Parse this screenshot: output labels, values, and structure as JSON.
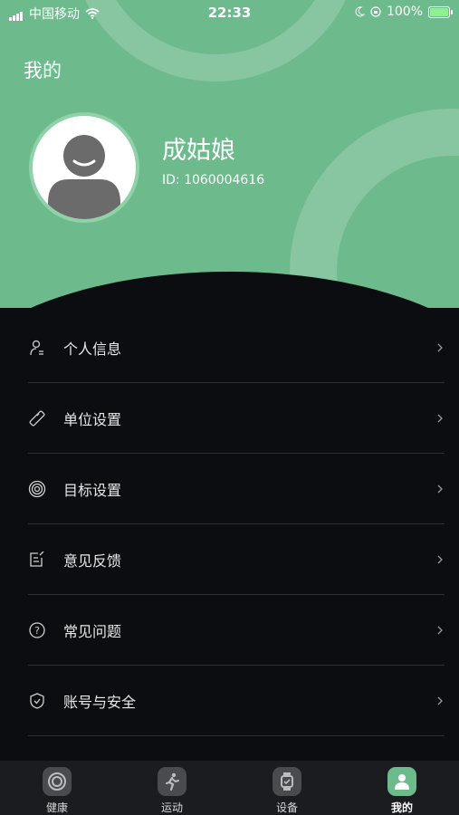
{
  "status_bar": {
    "carrier": "中国移动",
    "time": "22:33",
    "battery": "100%"
  },
  "header": {
    "title": "我的",
    "username": "成姑娘",
    "user_id": "ID: 1060004616"
  },
  "menu": [
    {
      "label": "个人信息",
      "icon": "person-card-icon"
    },
    {
      "label": "单位设置",
      "icon": "ruler-icon"
    },
    {
      "label": "目标设置",
      "icon": "target-icon"
    },
    {
      "label": "意见反馈",
      "icon": "feedback-icon"
    },
    {
      "label": "常见问题",
      "icon": "question-icon"
    },
    {
      "label": "账号与安全",
      "icon": "shield-icon"
    }
  ],
  "tabs": [
    {
      "label": "健康",
      "icon": "ring-icon"
    },
    {
      "label": "运动",
      "icon": "running-icon"
    },
    {
      "label": "设备",
      "icon": "watch-icon"
    },
    {
      "label": "我的",
      "icon": "person-icon",
      "active": true
    }
  ],
  "colors": {
    "accent": "#6dba8c",
    "background": "#0b0d10"
  }
}
